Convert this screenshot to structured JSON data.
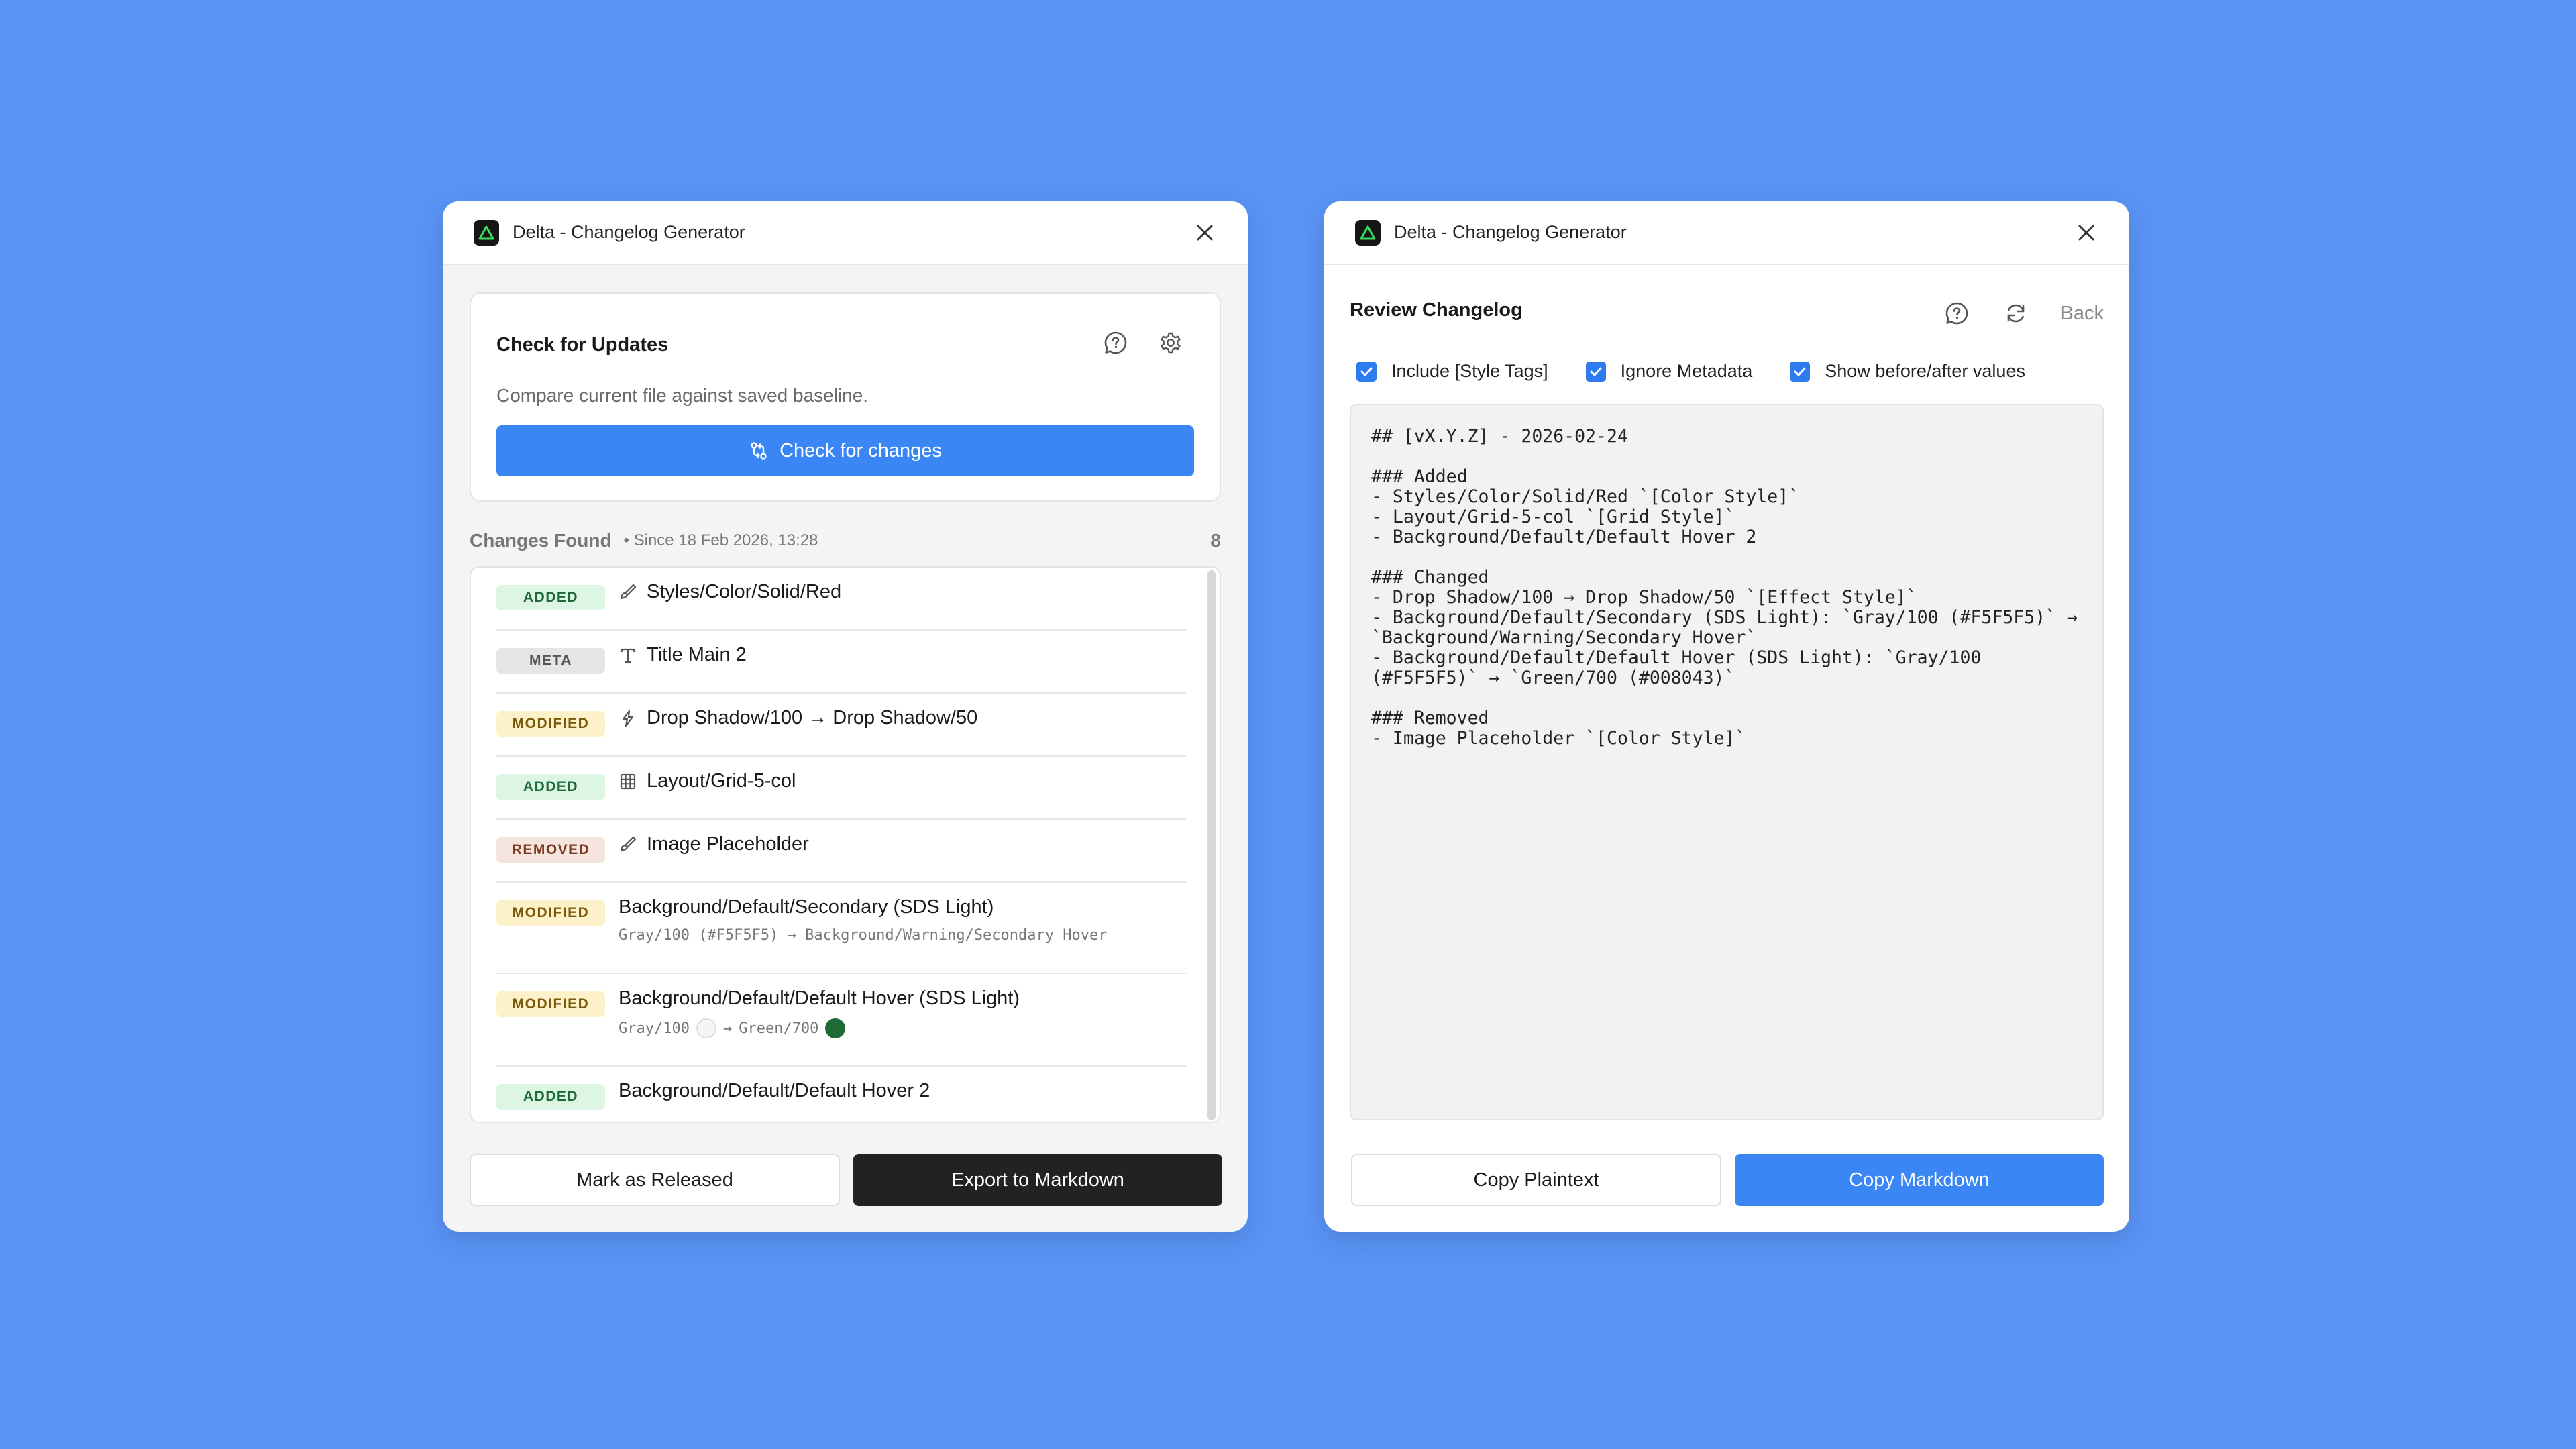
{
  "left_window": {
    "title": "Delta - Changelog Generator",
    "card": {
      "title": "Check for Updates",
      "description": "Compare current file against saved baseline.",
      "button_label": "Check for changes"
    },
    "changes": {
      "title": "Changes Found",
      "since": "• Since 18 Feb 2026, 13:28",
      "count": "8"
    },
    "rows": [
      {
        "badge": "ADDED",
        "kind": "added",
        "icon": "paintbrush-icon",
        "name": "Styles/Color/Solid/Red"
      },
      {
        "badge": "META",
        "kind": "meta",
        "icon": "text-icon",
        "name": "Title Main 2"
      },
      {
        "badge": "MODIFIED",
        "kind": "modified",
        "icon": "effect-icon",
        "name": "Drop Shadow/100 → Drop Shadow/50"
      },
      {
        "badge": "ADDED",
        "kind": "added",
        "icon": "grid-icon",
        "name": "Layout/Grid-5-col"
      },
      {
        "badge": "REMOVED",
        "kind": "removed",
        "icon": "paintbrush-icon",
        "name": "Image Placeholder"
      },
      {
        "badge": "MODIFIED",
        "kind": "modified",
        "name": "Background/Default/Secondary (SDS Light)",
        "sub": "Gray/100 (#F5F5F5) → Background/Warning/Secondary Hover"
      },
      {
        "badge": "MODIFIED",
        "kind": "modified",
        "name": "Background/Default/Default Hover (SDS Light)",
        "sub_from": "Gray/100",
        "sub_to": "Green/700",
        "from_color": "#F5F5F5",
        "to_color": "#1F6B35"
      },
      {
        "badge": "ADDED",
        "kind": "added",
        "name": "Background/Default/Default Hover 2"
      }
    ],
    "footer": {
      "mark_released": "Mark as Released",
      "export": "Export to Markdown"
    }
  },
  "right_window": {
    "title": "Delta - Changelog Generator",
    "review_title": "Review Changelog",
    "back_label": "Back",
    "options": [
      {
        "label": "Include [Style Tags]",
        "checked": true
      },
      {
        "label": "Ignore Metadata",
        "checked": true
      },
      {
        "label": "Show before/after values",
        "checked": true
      }
    ],
    "markdown": "## [vX.Y.Z] - 2026-02-24\n\n### Added\n- Styles/Color/Solid/Red `[Color Style]`\n- Layout/Grid-5-col `[Grid Style]`\n- Background/Default/Default Hover 2\n\n### Changed\n- Drop Shadow/100 → Drop Shadow/50 `[Effect Style]`\n- Background/Default/Secondary (SDS Light): `Gray/100 (#F5F5F5)` →\n`Background/Warning/Secondary Hover`\n- Background/Default/Default Hover (SDS Light): `Gray/100\n(#F5F5F5)` → `Green/700 (#008043)`\n\n### Removed\n- Image Placeholder `[Color Style]`",
    "footer": {
      "copy_plaintext": "Copy Plaintext",
      "copy_markdown": "Copy Markdown"
    }
  },
  "colors": {
    "background": "#5A94F5",
    "accent": "#3A86F5",
    "dark_button": "#222222",
    "app_icon_green": "#3DDC5F"
  }
}
